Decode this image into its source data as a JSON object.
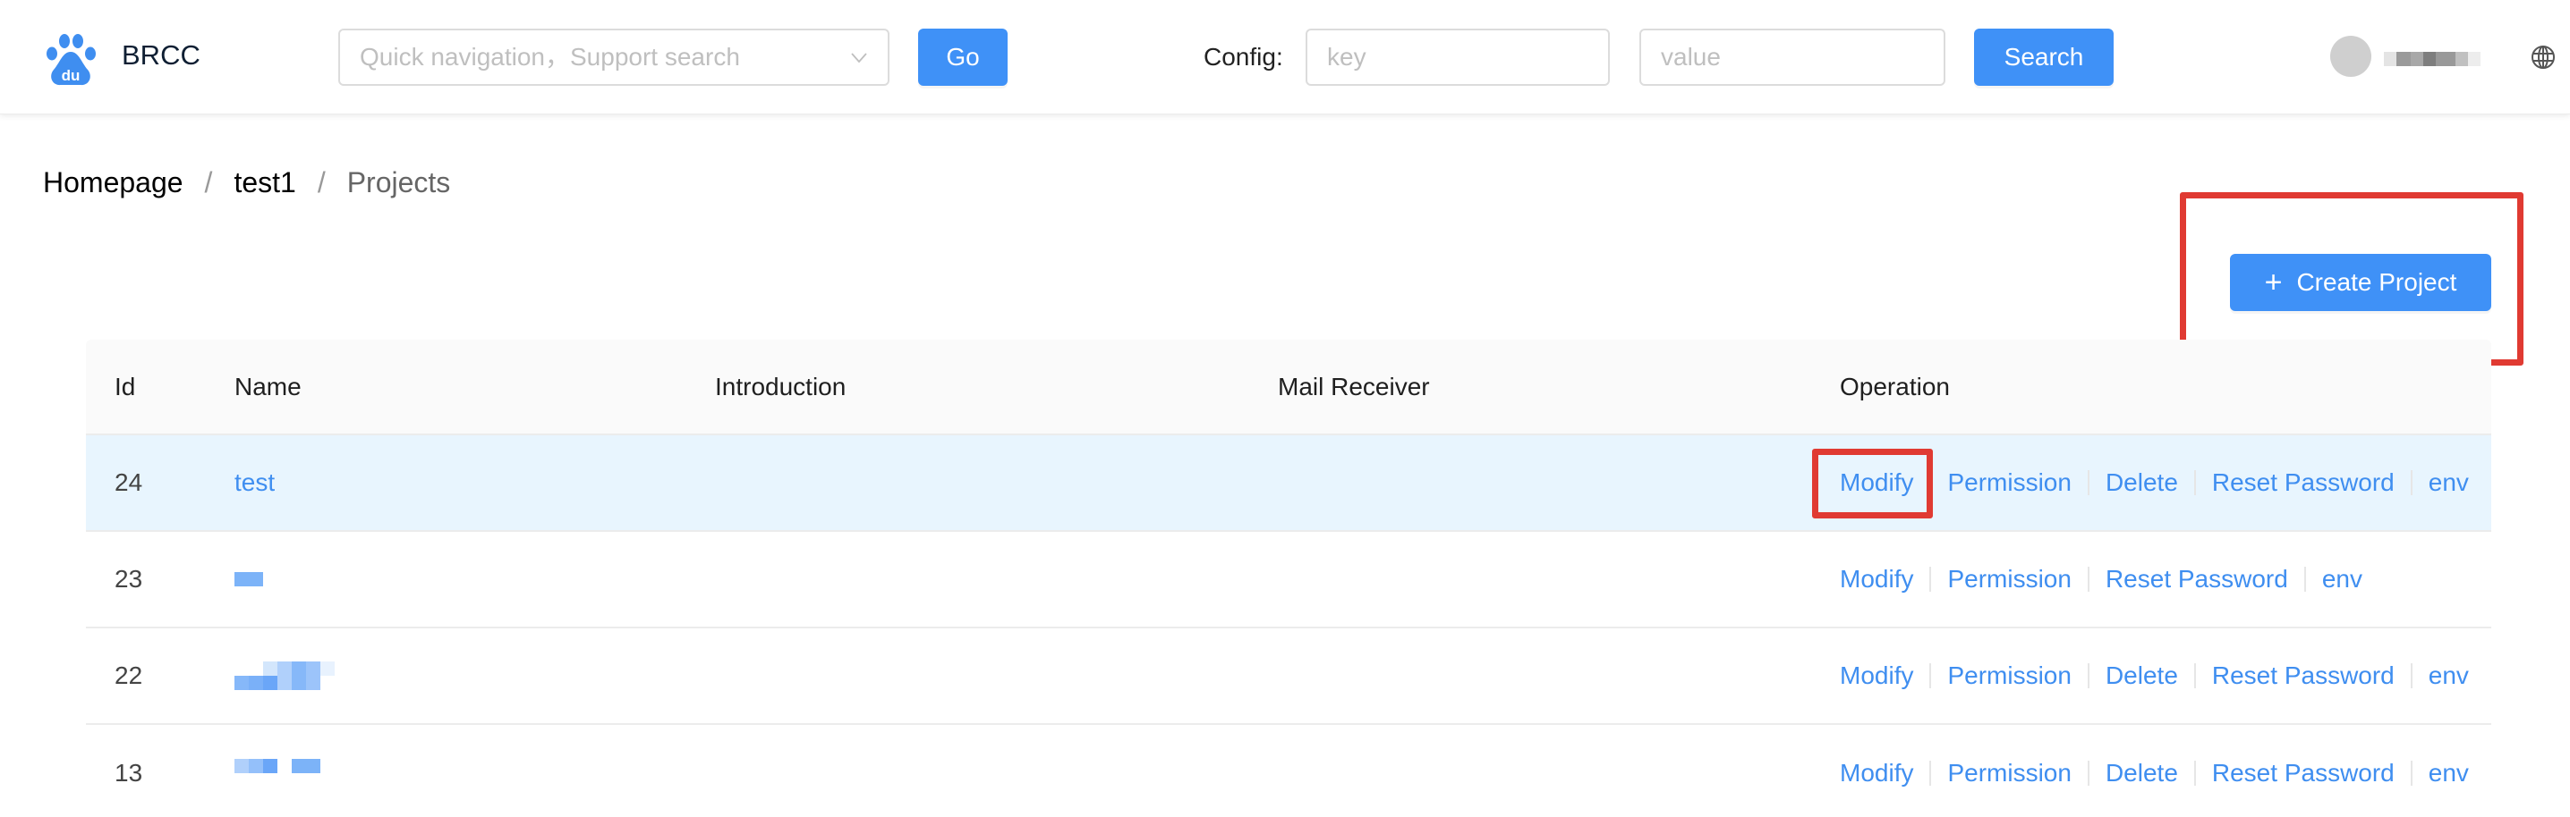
{
  "header": {
    "brand": "BRCC",
    "quick_nav": {
      "value": "",
      "placeholder": "Quick navigation，Support search"
    },
    "go_label": "Go",
    "config_label": "Config:",
    "key_field": {
      "value": "",
      "placeholder": "key"
    },
    "value_field": {
      "value": "",
      "placeholder": "value"
    },
    "search_label": "Search",
    "user": {
      "name_obscured": true
    },
    "colors": {
      "primary": "#3f91f7",
      "brand_text": "#0f1f33"
    }
  },
  "breadcrumb": {
    "items": [
      {
        "label": "Homepage"
      },
      {
        "label": "test1"
      },
      {
        "label": "Projects"
      }
    ],
    "separator": "/"
  },
  "actions": {
    "create_project_label": "Create Project",
    "highlight_color": "#e03a32"
  },
  "table": {
    "columns": [
      "Id",
      "Name",
      "Introduction",
      "Mail Receiver",
      "Operation"
    ],
    "rows": [
      {
        "id": "24",
        "name": "test",
        "name_obscured": false,
        "introduction": "",
        "mail_receiver": "",
        "operations": [
          "Modify",
          "Permission",
          "Delete",
          "Reset Password",
          "env"
        ],
        "highlighted": true
      },
      {
        "id": "23",
        "name": "",
        "name_obscured": true,
        "introduction": "",
        "mail_receiver": "",
        "operations": [
          "Modify",
          "Permission",
          "Reset Password",
          "env"
        ],
        "highlighted": false
      },
      {
        "id": "22",
        "name": "",
        "name_obscured": true,
        "introduction": "",
        "mail_receiver": "",
        "operations": [
          "Modify",
          "Permission",
          "Delete",
          "Reset Password",
          "env"
        ],
        "highlighted": false
      },
      {
        "id": "13",
        "name": "",
        "name_obscured": true,
        "introduction": "",
        "mail_receiver": "",
        "operations": [
          "Modify",
          "Permission",
          "Delete",
          "Reset Password",
          "env"
        ],
        "highlighted": false
      }
    ],
    "link_color": "#3f8ef0",
    "active_row_bg": "#e8f5fe"
  }
}
